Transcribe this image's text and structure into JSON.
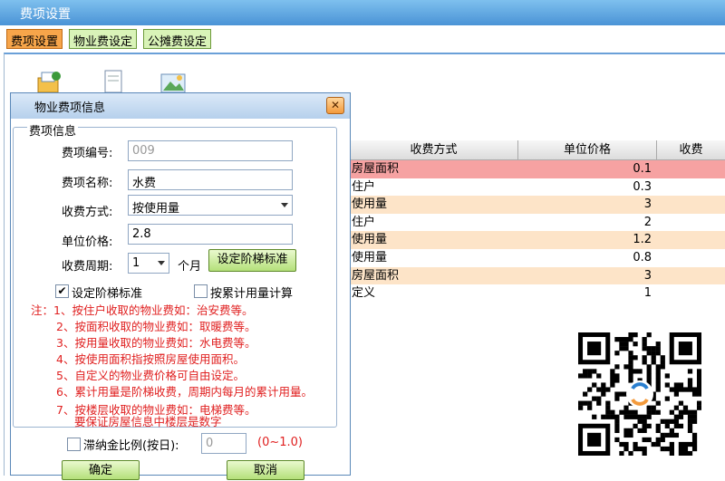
{
  "window": {
    "title": "费项设置"
  },
  "tabs": [
    {
      "label": "费项设置",
      "active": true
    },
    {
      "label": "物业费设定",
      "active": false
    },
    {
      "label": "公摊费设定",
      "active": false
    }
  ],
  "toolbar": {
    "icons": [
      "add-icon",
      "document-icon",
      "image-icon"
    ]
  },
  "grid": {
    "columns": [
      "收费方式",
      "单位价格",
      "收费"
    ],
    "rows": [
      {
        "method": "房屋面积",
        "price": "0.1",
        "selected": true
      },
      {
        "method": "住户",
        "price": "0.3"
      },
      {
        "method": "使用量",
        "price": "3"
      },
      {
        "method": "住户",
        "price": "2"
      },
      {
        "method": "使用量",
        "price": "1.2"
      },
      {
        "method": "使用量",
        "price": "0.8"
      },
      {
        "method": "房屋面积",
        "price": "3"
      },
      {
        "method": "定义",
        "price": "1"
      }
    ],
    "colors": {
      "odd": "#fde4c8",
      "even": "#ffffff",
      "selected": "#f6a2a2"
    }
  },
  "dialog": {
    "title": "物业费项信息",
    "group_label": "费项信息",
    "fields": {
      "code": {
        "label": "费项编号:",
        "value": "009"
      },
      "name": {
        "label": "费项名称:",
        "value": "水费"
      },
      "method": {
        "label": "收费方式:",
        "value": "按使用量"
      },
      "price": {
        "label": "单位价格:",
        "value": "2.8"
      },
      "cycle": {
        "label": "收费周期:",
        "value": "1",
        "unit": "个月"
      }
    },
    "step_button": "设定阶梯标准",
    "checkboxes": {
      "ladder": {
        "label": "设定阶梯标准",
        "checked": true
      },
      "cumulative": {
        "label": "按累计用量计算",
        "checked": false
      },
      "late_fee": {
        "label": "滞纳金比例(按日):",
        "checked": false
      }
    },
    "late_fee_value": "0",
    "late_fee_range": "(0~1.0)",
    "notes": [
      "注：1、按住户收取的物业费如：治安费等。",
      "2、按面积收取的物业费如：取暖费等。",
      "3、按用量收取的物业费如：水电费等。",
      "4、按使用面积指按照房屋使用面积。",
      "5、自定义的物业费价格可自由设定。",
      "6、累计用量是阶梯收费，周期内每月的累计用量。",
      "7、按楼层收取的物业费如：电梯费等。",
      "要保证房屋信息中楼层是数字"
    ],
    "buttons": {
      "ok": "确定",
      "cancel": "取消"
    }
  }
}
